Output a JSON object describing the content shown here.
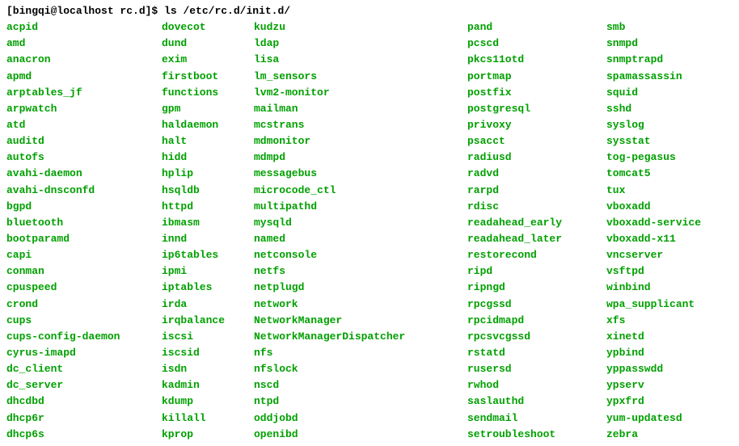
{
  "prompt": "[bingqi@localhost rc.d]$ ",
  "command": "ls /etc/rc.d/init.d/",
  "columns": [
    [
      "acpid",
      "amd",
      "anacron",
      "apmd",
      "arptables_jf",
      "arpwatch",
      "atd",
      "auditd",
      "autofs",
      "avahi-daemon",
      "avahi-dnsconfd",
      "bgpd",
      "bluetooth",
      "bootparamd",
      "capi",
      "conman",
      "cpuspeed",
      "crond",
      "cups",
      "cups-config-daemon",
      "cyrus-imapd",
      "dc_client",
      "dc_server",
      "dhcdbd",
      "dhcp6r",
      "dhcp6s"
    ],
    [
      "dovecot",
      "dund",
      "exim",
      "firstboot",
      "functions",
      "gpm",
      "haldaemon",
      "halt",
      "hidd",
      "hplip",
      "hsqldb",
      "httpd",
      "ibmasm",
      "innd",
      "ip6tables",
      "ipmi",
      "iptables",
      "irda",
      "irqbalance",
      "iscsi",
      "iscsid",
      "isdn",
      "kadmin",
      "kdump",
      "killall",
      "kprop"
    ],
    [
      "kudzu",
      "ldap",
      "lisa",
      "lm_sensors",
      "lvm2-monitor",
      "mailman",
      "mcstrans",
      "mdmonitor",
      "mdmpd",
      "messagebus",
      "microcode_ctl",
      "multipathd",
      "mysqld",
      "named",
      "netconsole",
      "netfs",
      "netplugd",
      "network",
      "NetworkManager",
      "NetworkManagerDispatcher",
      "nfs",
      "nfslock",
      "nscd",
      "ntpd",
      "oddjobd",
      "openibd"
    ],
    [
      "pand",
      "pcscd",
      "pkcs11otd",
      "portmap",
      "postfix",
      "postgresql",
      "privoxy",
      "psacct",
      "radiusd",
      "radvd",
      "rarpd",
      "rdisc",
      "readahead_early",
      "readahead_later",
      "restorecond",
      "ripd",
      "ripngd",
      "rpcgssd",
      "rpcidmapd",
      "rpcsvcgssd",
      "rstatd",
      "rusersd",
      "rwhod",
      "saslauthd",
      "sendmail",
      "setroubleshoot"
    ],
    [
      "smb",
      "snmpd",
      "snmptrapd",
      "spamassassin",
      "squid",
      "sshd",
      "syslog",
      "sysstat",
      "tog-pegasus",
      "tomcat5",
      "tux",
      "vboxadd",
      "vboxadd-service",
      "vboxadd-x11",
      "vncserver",
      "vsftpd",
      "winbind",
      "wpa_supplicant",
      "xfs",
      "xinetd",
      "ypbind",
      "yppasswdd",
      "ypserv",
      "ypxfrd",
      "yum-updatesd",
      "zebra"
    ]
  ]
}
